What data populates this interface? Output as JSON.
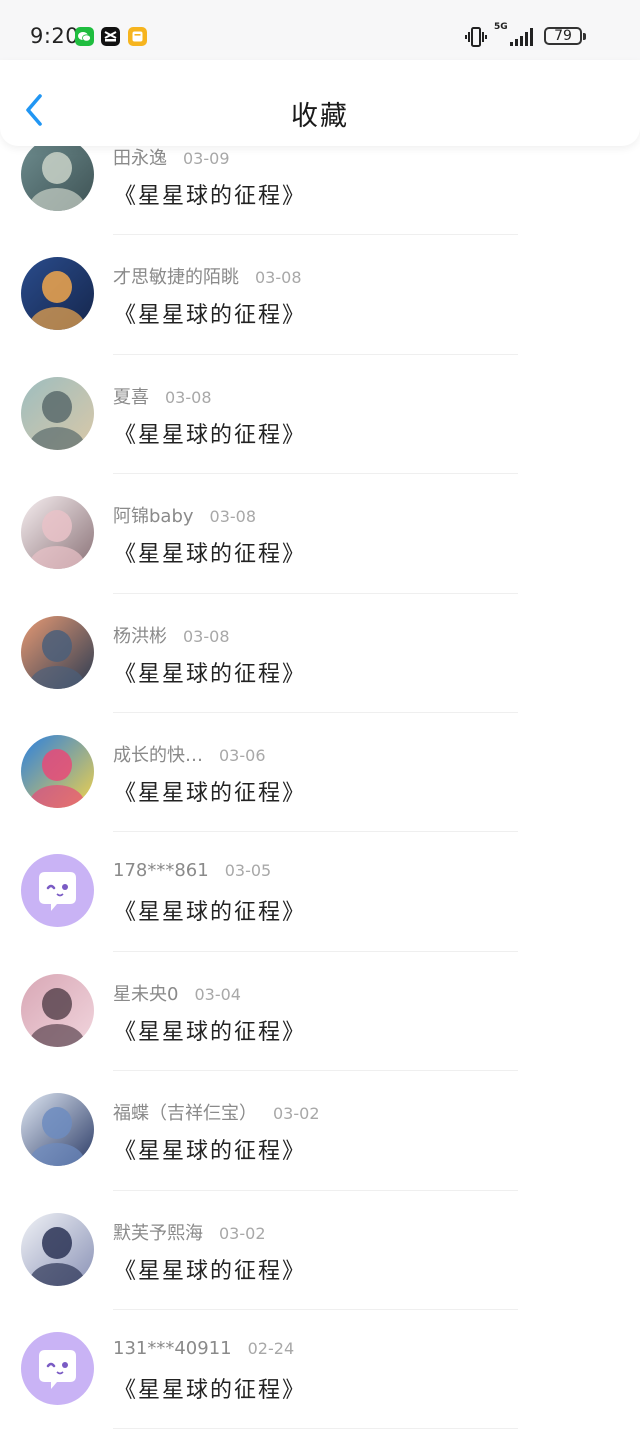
{
  "status_bar": {
    "time": "9:20",
    "network": "5G",
    "battery": "79",
    "app_icons": [
      "wechat-icon",
      "capcut-icon",
      "notes-icon"
    ]
  },
  "header": {
    "title": "收藏",
    "back_icon": "chevron-left-icon",
    "accent_color": "#2196f3"
  },
  "favorites": [
    {
      "user": "田永逸",
      "date": "03-09",
      "title": "《星星球的征程》",
      "avatar": {
        "kind": "photo",
        "colors": [
          "#6e8d8f",
          "#c9d2c8",
          "#3e5254"
        ]
      }
    },
    {
      "user": "才思敏捷的陌眺",
      "date": "03-08",
      "title": "《星星球的征程》",
      "avatar": {
        "kind": "photo",
        "colors": [
          "#2a4c8c",
          "#f0a64c",
          "#15264c"
        ]
      }
    },
    {
      "user": "夏喜",
      "date": "03-08",
      "title": "《星星球的征程》",
      "avatar": {
        "kind": "photo",
        "colors": [
          "#9dbdbf",
          "#5a6b6c",
          "#d9c8a8"
        ]
      }
    },
    {
      "user": "阿锦baby",
      "date": "03-08",
      "title": "《星星球的征程》",
      "avatar": {
        "kind": "photo",
        "colors": [
          "#f6eef0",
          "#e9c2c8",
          "#8a7277"
        ]
      }
    },
    {
      "user": "杨洪彬",
      "date": "03-08",
      "title": "《星星球的征程》",
      "avatar": {
        "kind": "photo",
        "colors": [
          "#e79a74",
          "#4b5f7a",
          "#2b3b52"
        ]
      }
    },
    {
      "user": "成长的快…",
      "date": "03-06",
      "title": "《星星球的征程》",
      "avatar": {
        "kind": "photo",
        "colors": [
          "#2a7fe0",
          "#e84a78",
          "#f2d24a"
        ]
      }
    },
    {
      "user": "178***861",
      "date": "03-05",
      "title": "《星星球的征程》",
      "avatar": {
        "kind": "default",
        "colors": [
          "#c9b3f5",
          "#ffffff",
          "#7a5bc4"
        ]
      }
    },
    {
      "user": "星未央0",
      "date": "03-04",
      "title": "《星星球的征程》",
      "avatar": {
        "kind": "photo",
        "colors": [
          "#d8a7b5",
          "#5b4550",
          "#f1d5dd"
        ]
      }
    },
    {
      "user": "福蝶（吉祥仨宝）",
      "date": "03-02",
      "title": "《星星球的征程》",
      "avatar": {
        "kind": "photo",
        "colors": [
          "#dfe7f3",
          "#6d8cc0",
          "#2b3b66"
        ]
      }
    },
    {
      "user": "默芙予熙海",
      "date": "03-02",
      "title": "《星星球的征程》",
      "avatar": {
        "kind": "photo",
        "colors": [
          "#f0f2f6",
          "#2c3456",
          "#8a92b6"
        ]
      }
    },
    {
      "user": "131***40911",
      "date": "02-24",
      "title": "《星星球的征程》",
      "avatar": {
        "kind": "default",
        "colors": [
          "#c9b3f5",
          "#ffffff",
          "#7a5bc4"
        ]
      }
    }
  ]
}
